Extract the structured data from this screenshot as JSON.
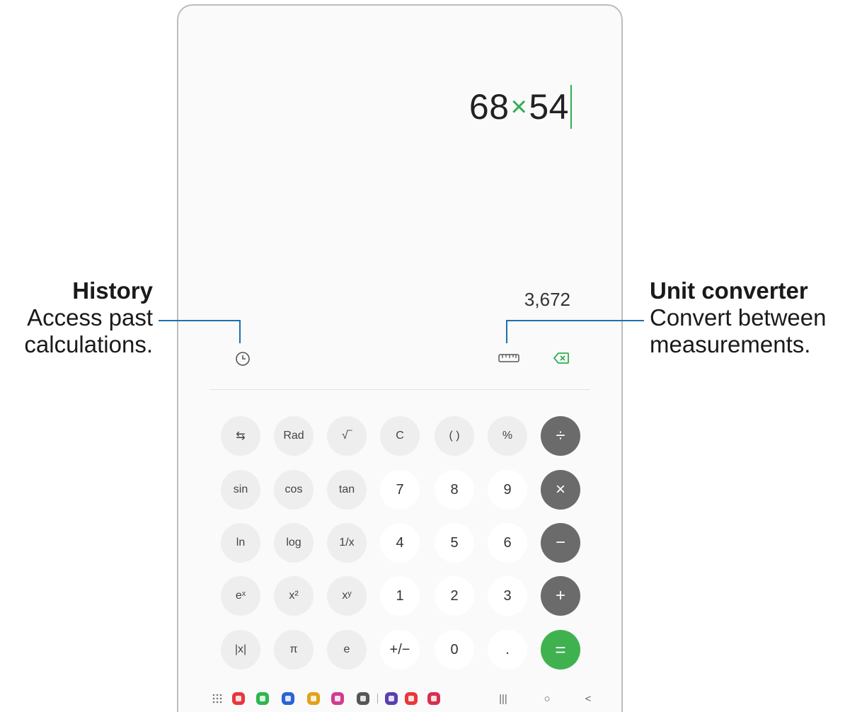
{
  "calculator": {
    "expression_left": "68",
    "expression_op": "×",
    "expression_right": "54",
    "result": "3,672",
    "icons": {
      "history": "clock-icon",
      "unit_converter": "ruler-icon",
      "backspace": "backspace-icon"
    },
    "keypad_rows": [
      [
        {
          "label": "⇆",
          "type": "sci",
          "name": "switch-key"
        },
        {
          "label": "Rad",
          "type": "sci",
          "name": "rad-key"
        },
        {
          "label": "√‾",
          "type": "sci",
          "name": "sqrt-key"
        },
        {
          "label": "C",
          "type": "sci",
          "name": "clear-key"
        },
        {
          "label": "( )",
          "type": "sci",
          "name": "parentheses-key"
        },
        {
          "label": "%",
          "type": "sci",
          "name": "percent-key"
        },
        {
          "label": "÷",
          "type": "op",
          "name": "divide-key"
        }
      ],
      [
        {
          "label": "sin",
          "type": "sci",
          "name": "sin-key"
        },
        {
          "label": "cos",
          "type": "sci",
          "name": "cos-key"
        },
        {
          "label": "tan",
          "type": "sci",
          "name": "tan-key"
        },
        {
          "label": "7",
          "type": "num",
          "name": "digit-7-key"
        },
        {
          "label": "8",
          "type": "num",
          "name": "digit-8-key"
        },
        {
          "label": "9",
          "type": "num",
          "name": "digit-9-key"
        },
        {
          "label": "×",
          "type": "op",
          "name": "multiply-key"
        }
      ],
      [
        {
          "label": "ln",
          "type": "sci",
          "name": "ln-key"
        },
        {
          "label": "log",
          "type": "sci",
          "name": "log-key"
        },
        {
          "label": "1/x",
          "type": "sci",
          "name": "reciprocal-key"
        },
        {
          "label": "4",
          "type": "num",
          "name": "digit-4-key"
        },
        {
          "label": "5",
          "type": "num",
          "name": "digit-5-key"
        },
        {
          "label": "6",
          "type": "num",
          "name": "digit-6-key"
        },
        {
          "label": "−",
          "type": "op",
          "name": "minus-key"
        }
      ],
      [
        {
          "label": "eˣ",
          "type": "sci",
          "name": "exp-key"
        },
        {
          "label": "x²",
          "type": "sci",
          "name": "square-key"
        },
        {
          "label": "xʸ",
          "type": "sci",
          "name": "power-key"
        },
        {
          "label": "1",
          "type": "num",
          "name": "digit-1-key"
        },
        {
          "label": "2",
          "type": "num",
          "name": "digit-2-key"
        },
        {
          "label": "3",
          "type": "num",
          "name": "digit-3-key"
        },
        {
          "label": "+",
          "type": "op",
          "name": "plus-key"
        }
      ],
      [
        {
          "label": "|x|",
          "type": "sci",
          "name": "abs-key"
        },
        {
          "label": "π",
          "type": "sci",
          "name": "pi-key"
        },
        {
          "label": "e",
          "type": "sci",
          "name": "e-key"
        },
        {
          "label": "+/−",
          "type": "num",
          "name": "sign-key"
        },
        {
          "label": "0",
          "type": "num",
          "name": "digit-0-key"
        },
        {
          "label": ".",
          "type": "num",
          "name": "decimal-key"
        },
        {
          "label": "=",
          "type": "eq",
          "name": "equals-key"
        }
      ]
    ],
    "op_color": "#6b6b6b",
    "equals_color": "#3fb24f",
    "accent_color": "#2fae52"
  },
  "navbar": {
    "dock_apps": [
      {
        "icon": "apps-grid-icon",
        "color": "#777777"
      },
      {
        "icon": "red-app-icon",
        "color": "#e8383b"
      },
      {
        "icon": "phone-icon",
        "color": "#2db74c"
      },
      {
        "icon": "messages-icon",
        "color": "#2a62d8"
      },
      {
        "icon": "chrome-icon",
        "color": "#e0a21b"
      },
      {
        "icon": "gallery-icon",
        "color": "#d03c8e"
      },
      {
        "icon": "camera-icon",
        "color": "#555555"
      },
      {
        "icon": "clock-app-icon",
        "color": "#5a3fb0"
      },
      {
        "icon": "multi-app-icon",
        "color": "#e8383b"
      },
      {
        "icon": "store-icon",
        "color": "#d6304f"
      }
    ],
    "buttons": [
      {
        "label": "|||",
        "name": "recents-button"
      },
      {
        "label": "○",
        "name": "home-button"
      },
      {
        "label": "<",
        "name": "back-button"
      }
    ]
  },
  "annotations": {
    "history": {
      "title": "History",
      "line1": "Access past",
      "line2": "calculations."
    },
    "unit_converter": {
      "title": "Unit converter",
      "line1": "Convert between",
      "line2": "measurements."
    },
    "line_color": "#1e6fae"
  }
}
